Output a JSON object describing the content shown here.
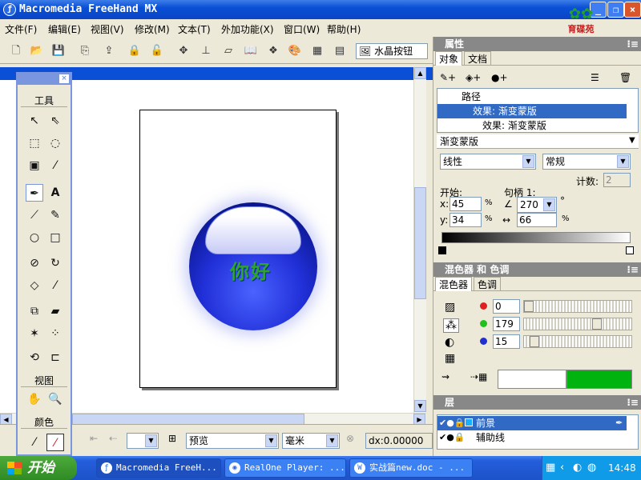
{
  "window": {
    "title": "Macromedia FreeHand MX"
  },
  "logo": {
    "text": "育碟苑"
  },
  "menu": [
    "文件(F)",
    "编辑(E)",
    "视图(V)",
    "修改(M)",
    "文本(T)",
    "外加功能(X)",
    "窗口(W)",
    "帮助(H)"
  ],
  "toolbar": {
    "style_combo": "水晶按钮"
  },
  "canvas": {
    "text": "你好"
  },
  "tools_panel": {
    "title": "工具",
    "view_label": "视图",
    "color_label": "颜色"
  },
  "statusbar": {
    "view_mode": "预览",
    "unit": "毫米",
    "dx": "dx:0.00000"
  },
  "properties": {
    "title": "属性",
    "tabs": [
      "对象",
      "文档"
    ],
    "items": [
      "路径",
      "效果: 渐变蒙版",
      "效果: 渐变蒙版"
    ],
    "effect_name": "渐变蒙版",
    "gradient_type": "线性",
    "blend_mode": "常规",
    "count_label": "计数:",
    "count_value": "2",
    "start_label": "开始:",
    "handle_label": "句柄 1:",
    "x_label": "x:",
    "x_value": "45",
    "y_label": "y:",
    "y_value": "34",
    "angle_value": "270",
    "length_value": "66",
    "percent": "%",
    "degree": "°"
  },
  "mixer": {
    "title": "混色器 和 色调",
    "tabs": [
      "混色器",
      "色调"
    ],
    "r": "0",
    "g": "179",
    "b": "15",
    "color": "#00b30f",
    "levels": {
      "r": 0,
      "g": 0.7,
      "b": 0.06
    }
  },
  "layers": {
    "title": "层",
    "items": [
      "前景",
      "辅助线"
    ]
  },
  "taskbar": {
    "start": "开始",
    "tasks": [
      "Macromedia FreeH...",
      "RealOne Player: ...",
      "实战篇new.doc - ..."
    ],
    "clock": "14:48"
  }
}
